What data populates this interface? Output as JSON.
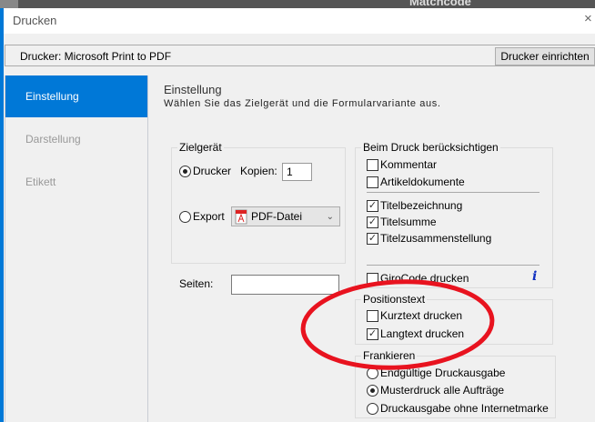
{
  "background_window": {
    "column_header": "Matchcode"
  },
  "dialog": {
    "title": "Drucken",
    "close": "×"
  },
  "printer_bar": {
    "label": "Drucker: Microsoft Print to PDF",
    "setup_button": "Drucker einrichten"
  },
  "sidebar": {
    "items": [
      {
        "label": "Einstellung",
        "selected": true
      },
      {
        "label": "Darstellung"
      },
      {
        "label": "Etikett"
      }
    ]
  },
  "main": {
    "heading": "Einstellung",
    "subheading": "Wählen Sie das Zielgerät und die Formularvariante aus."
  },
  "zielgeraet": {
    "legend": "Zielgerät",
    "drucker": "Drucker",
    "kopien_label": "Kopien:",
    "kopien_value": "1",
    "export": "Export",
    "export_format": "PDF-Datei",
    "selected": "Drucker"
  },
  "seiten": {
    "label": "Seiten:",
    "value": ""
  },
  "beim_druck": {
    "legend": "Beim Druck berücksichtigen",
    "items": [
      {
        "label": "Kommentar",
        "checked": false
      },
      {
        "label": "Artikeldokumente",
        "checked": false
      },
      {
        "label": "Titelbezeichnung",
        "checked": true
      },
      {
        "label": "Titelsumme",
        "checked": true
      },
      {
        "label": "Titelzusammenstellung",
        "checked": true
      },
      {
        "label": "GiroCode drucken",
        "checked": false
      }
    ]
  },
  "positionstext": {
    "legend": "Positionstext",
    "items": [
      {
        "label": "Kurztext drucken",
        "checked": false
      },
      {
        "label": "Langtext drucken",
        "checked": true
      }
    ]
  },
  "frankieren": {
    "legend": "Frankieren",
    "options": [
      {
        "label": "Endgültige Druckausgabe",
        "selected": false
      },
      {
        "label": "Musterdruck alle Aufträge",
        "selected": true
      },
      {
        "label": "Druckausgabe ohne Internetmarke",
        "selected": false
      }
    ]
  },
  "annotation_color": "#e8131f"
}
